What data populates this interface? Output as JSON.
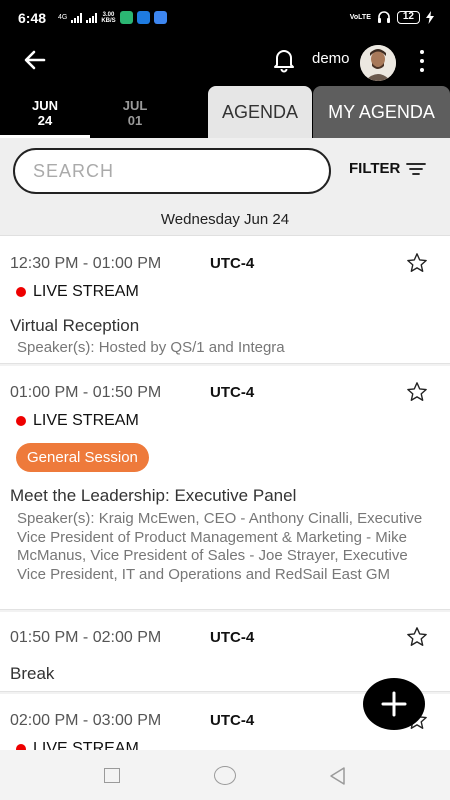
{
  "status_bar": {
    "time": "6:48",
    "signal_label": "4G",
    "net_speed_value": "3.00",
    "net_speed_unit": "KB/S",
    "volte_label": "VoLTE",
    "battery_level": "12"
  },
  "header": {
    "user_name": "demo"
  },
  "date_tabs": [
    {
      "month": "JUN",
      "day": "24",
      "active": true
    },
    {
      "month": "JUL",
      "day": "01",
      "active": false
    }
  ],
  "view_tabs": {
    "agenda": "AGENDA",
    "my_agenda": "MY AGENDA"
  },
  "search": {
    "placeholder": "SEARCH",
    "filter_label": "FILTER"
  },
  "date_header": "Wednesday Jun 24",
  "sessions": [
    {
      "time": "12:30 PM - 01:00 PM",
      "timezone": "UTC-4",
      "live": "LIVE STREAM",
      "title": "Virtual Reception",
      "speakers": "Speaker(s): Hosted by QS/1 and Integra"
    },
    {
      "time": "01:00 PM - 01:50 PM",
      "timezone": "UTC-4",
      "live": "LIVE STREAM",
      "badge": "General Session",
      "title": "Meet the Leadership: Executive Panel",
      "speakers": "Speaker(s): Kraig McEwen, CEO - Anthony Cinalli, Executive Vice President of Product Management & Marketing - Mike McManus, Vice President of Sales - Joe Strayer, Executive Vice President, IT and Operations and RedSail East GM"
    },
    {
      "time": "01:50 PM - 02:00 PM",
      "timezone": "UTC-4",
      "title": "Break"
    },
    {
      "time": "02:00 PM - 03:00 PM",
      "timezone": "UTC-4",
      "live": "LIVE STREAM"
    }
  ],
  "colors": {
    "accent_badge": "#ee7a3b",
    "live_dot": "#ee0000",
    "header_bg": "#000000"
  }
}
